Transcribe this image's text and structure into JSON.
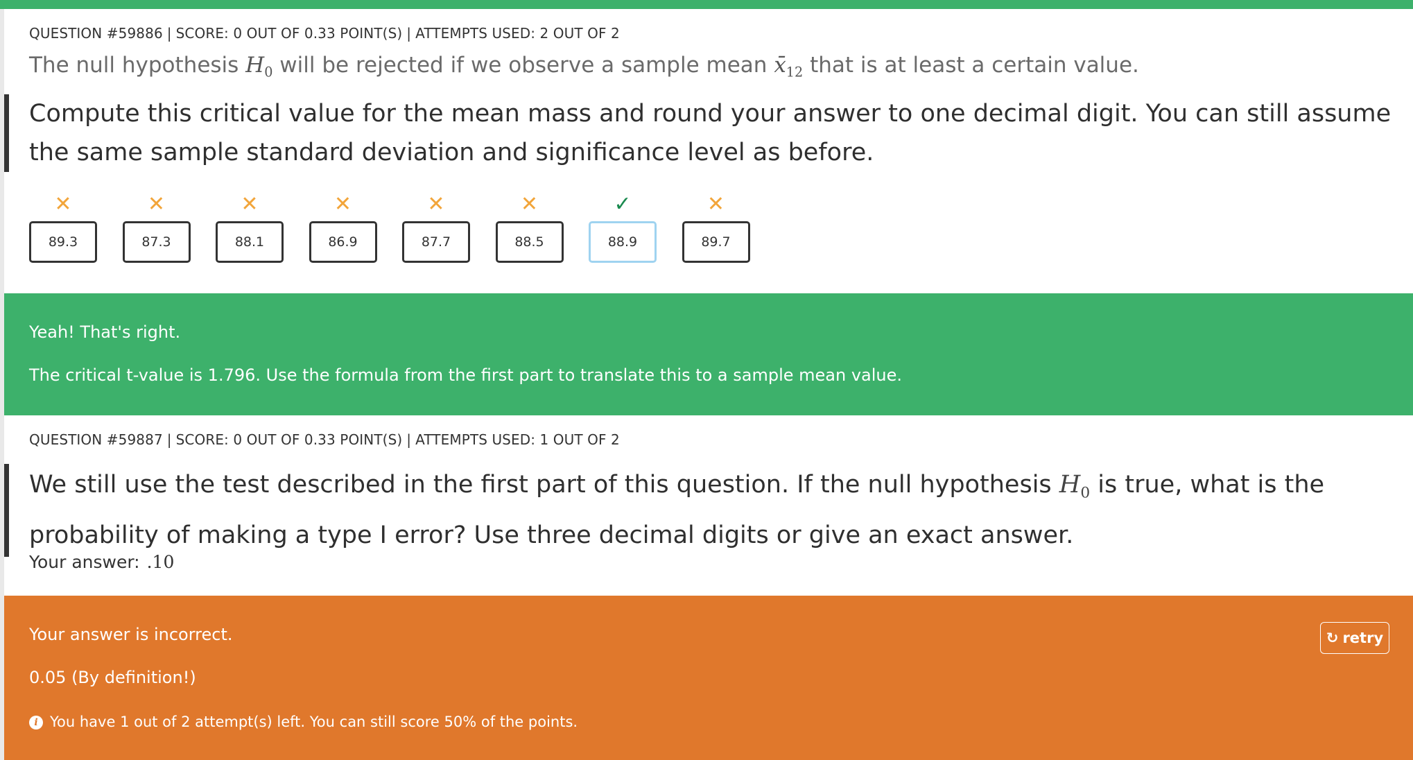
{
  "colors": {
    "success": "#3db16b",
    "error": "#e0782c",
    "wrong_mark": "#f2a53a",
    "correct_mark": "#1a8a4f",
    "selected_border": "#9fd3f0"
  },
  "q1": {
    "number_label": "QUESTION #59886",
    "score_label": "SCORE: 0 OUT OF 0.33 POINT(S)",
    "attempts_label": "ATTEMPTS USED: 2 OUT OF 2",
    "intro_before": "The null hypothesis",
    "h0_symbol": "H",
    "h0_sub": "0",
    "intro_middle": "will be rejected if we observe a sample mean",
    "xbar_symbol": "x̄",
    "xbar_sub": "12",
    "intro_after": "that is at least a certain value.",
    "text": "Compute this critical value for the mean mass and round your answer to one decimal digit. You can still assume the same sample standard deviation and significance level as before.",
    "options": [
      {
        "value": "89.3",
        "mark": "✕",
        "mark_icon": "cross-icon"
      },
      {
        "value": "87.3",
        "mark": "✕",
        "mark_icon": "cross-icon"
      },
      {
        "value": "88.1",
        "mark": "✕",
        "mark_icon": "cross-icon"
      },
      {
        "value": "86.9",
        "mark": "✕",
        "mark_icon": "cross-icon"
      },
      {
        "value": "87.7",
        "mark": "✕",
        "mark_icon": "cross-icon"
      },
      {
        "value": "88.5",
        "mark": "✕",
        "mark_icon": "cross-icon"
      },
      {
        "value": "88.9",
        "mark": "✓",
        "mark_icon": "check-icon"
      },
      {
        "value": "89.7",
        "mark": "✕",
        "mark_icon": "cross-icon"
      }
    ],
    "feedback_title": "Yeah! That's right.",
    "feedback_text": "The critical t-value is 1.796. Use the formula from the first part to translate this to a sample mean value."
  },
  "q2": {
    "number_label": "QUESTION #59887",
    "score_label": "SCORE: 0 OUT OF 0.33 POINT(S)",
    "attempts_label": "ATTEMPTS USED: 1 OUT OF 2",
    "text_before": "We still use the test described in the first part of this question. If the null hypothesis",
    "h0_symbol": "H",
    "h0_sub": "0",
    "text_after": "is true, what is the probability of making a type I error? Use three decimal digits or give an exact answer.",
    "answer_label": "Your answer:",
    "answer_value": ".10",
    "feedback_title": "Your answer is incorrect.",
    "feedback_solution": "0.05 (By definition!)",
    "attempts_info": "You have 1 out of 2 attempt(s) left. You can still score 50% of the points.",
    "retry_label": "retry",
    "retry_icon": "↻",
    "info_icon": "i"
  }
}
